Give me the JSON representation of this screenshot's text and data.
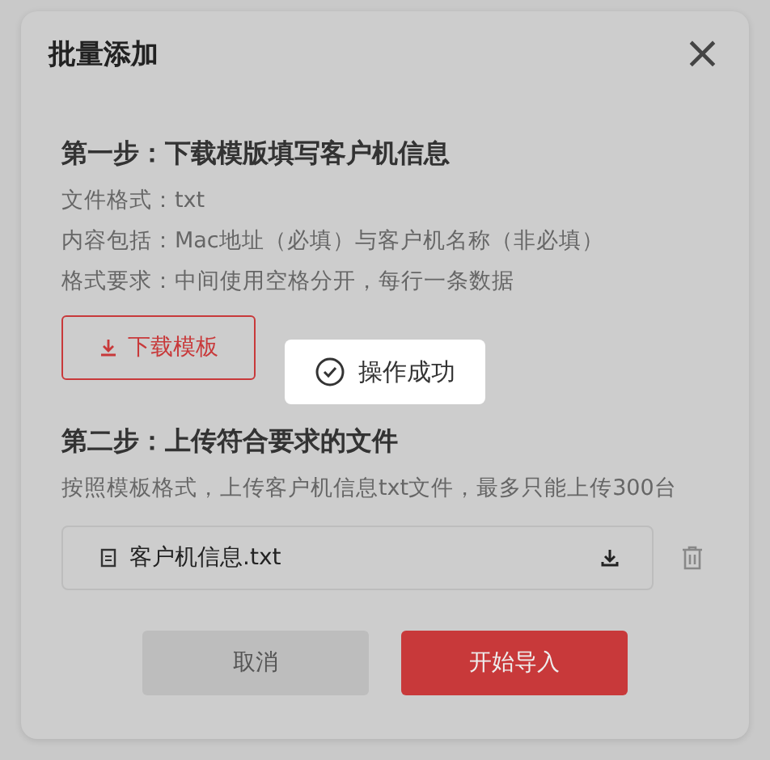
{
  "dialog": {
    "title": "批量添加",
    "close": "×"
  },
  "step1": {
    "heading": "第一步：下载模版填写客户机信息",
    "lines": [
      "文件格式：txt",
      "内容包括：Mac地址（必填）与客户机名称（非必填）",
      "格式要求：中间使用空格分开，每行一条数据"
    ],
    "download_button": "下载模板"
  },
  "toast": {
    "message": "操作成功"
  },
  "step2": {
    "heading": "第二步：上传符合要求的文件",
    "description": "按照模板格式，上传客户机信息txt文件，最多只能上传300台",
    "file": {
      "name": "客户机信息.txt"
    }
  },
  "buttons": [
    {
      "label": "取消",
      "kind": "secondary"
    },
    {
      "label": "开始导入",
      "kind": "primary"
    }
  ]
}
